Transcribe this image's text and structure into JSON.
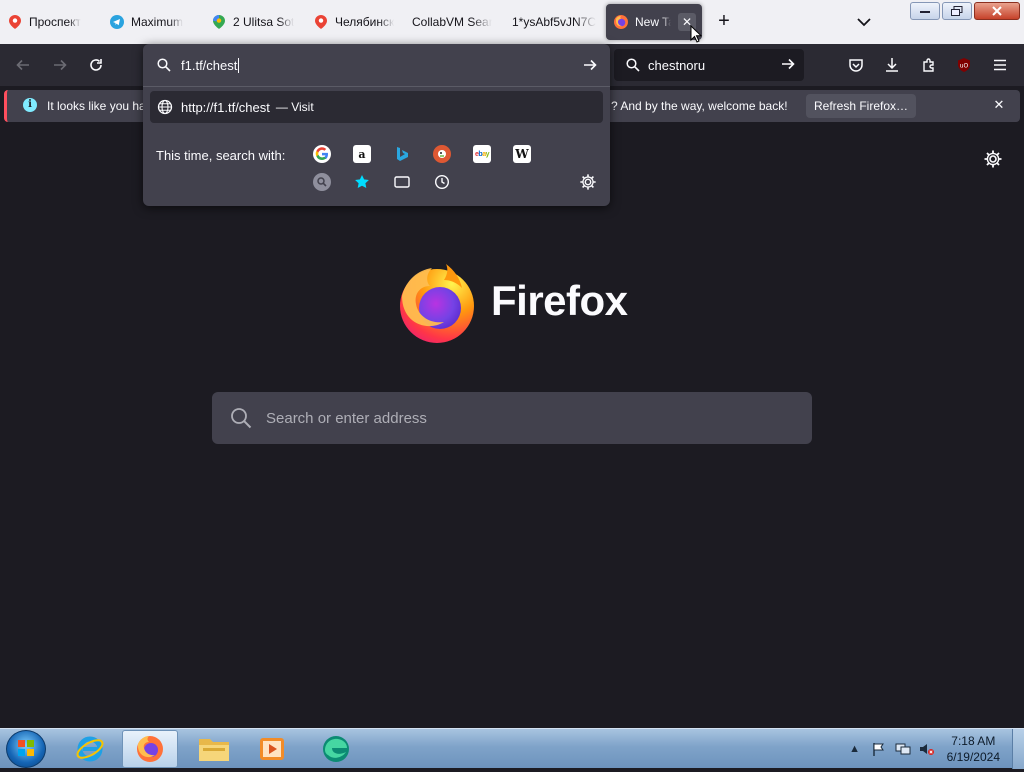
{
  "tabs": [
    {
      "label": "Проспект",
      "icon": "map-pin-icon"
    },
    {
      "label": "Maximum",
      "icon": "telegram-icon"
    },
    {
      "label": "2 Ulitsa Sot",
      "icon": "google-maps-icon"
    },
    {
      "label": "Челябинск",
      "icon": "map-pin-icon"
    },
    {
      "label": "CollabVM Sear",
      "icon": ""
    },
    {
      "label": "1*ysAbf5vJN7C",
      "icon": ""
    },
    {
      "label": "New Tab",
      "icon": "firefox-icon",
      "active": true
    }
  ],
  "tab_close_label": "✕",
  "new_tab_label": "+",
  "urlbar": {
    "typed_value": "f1.tf/chest",
    "suggestion_url": "http://f1.tf/chest",
    "suggestion_action": "— Visit",
    "oneoff_label": "This time, search with:",
    "engines": [
      "google",
      "amazon",
      "bing",
      "duckduckgo",
      "ebay",
      "wikipedia"
    ],
    "modes": [
      "search-mode",
      "bookmarks",
      "tabs",
      "history"
    ]
  },
  "searchbar": {
    "value": "chestnoru"
  },
  "notification": {
    "message_left": "It looks like you ha",
    "message_right": "? And by the way, welcome back!",
    "button_label": "Refresh Firefox…",
    "close_label": "✕"
  },
  "content": {
    "wordmark": "Firefox",
    "search_placeholder": "Search or enter address"
  },
  "taskbar": {
    "time": "7:18 AM",
    "date": "6/19/2024",
    "apps": [
      "internet-explorer",
      "firefox",
      "file-explorer",
      "media-player",
      "edge"
    ]
  },
  "colors": {
    "accent": "#ff4f5e",
    "info": "#80ebff",
    "toolbar": "#2b2a33",
    "content_bg": "#1c1b22",
    "field_bg": "#42414d"
  }
}
